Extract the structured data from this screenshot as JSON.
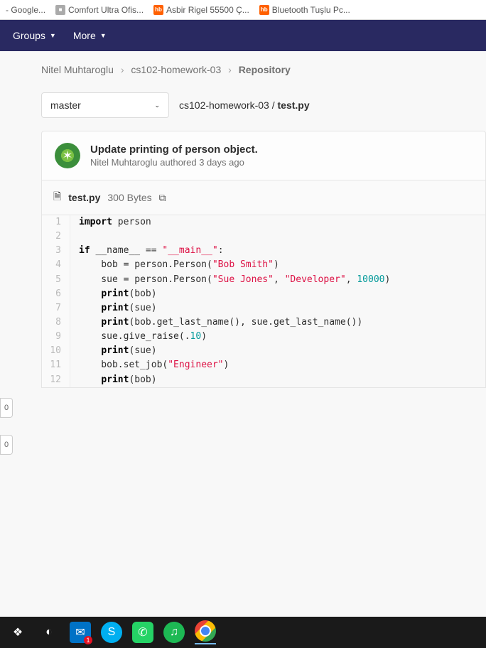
{
  "bookmarks": {
    "b0": "- Google...",
    "b1": "Comfort Ultra Ofis...",
    "b2": "Asbir Rigel 55500 Ç...",
    "b3": "Bluetooth Tuşlu Pc...",
    "hb": "hb"
  },
  "nav": {
    "groups": "Groups",
    "more": "More"
  },
  "breadcrumb": {
    "user": "Nitel Muhtaroglu",
    "project": "cs102-homework-03",
    "page": "Repository"
  },
  "branch": {
    "name": "master"
  },
  "path": {
    "folder": "cs102-homework-03",
    "sep": " / ",
    "file": "test.py"
  },
  "commit": {
    "title": "Update printing of person object.",
    "author": "Nitel Muhtaroglu",
    "verb": " authored ",
    "time": "3 days ago"
  },
  "fileheader": {
    "name": "test.py",
    "size": "300 Bytes"
  },
  "code": {
    "lines": [
      {
        "n": "1",
        "html": "<span class='kw'>import</span> person"
      },
      {
        "n": "2",
        "html": ""
      },
      {
        "n": "3",
        "html": "<span class='kw'>if</span> __name__ == <span class='str'>\"__main__\"</span>:"
      },
      {
        "n": "4",
        "html": "    bob = person.Person(<span class='str'>\"Bob Smith\"</span>)"
      },
      {
        "n": "5",
        "html": "    sue = person.Person(<span class='str'>\"Sue Jones\"</span>, <span class='str'>\"Developer\"</span>, <span class='num'>10000</span>)"
      },
      {
        "n": "6",
        "html": "    <span class='kw'>print</span>(bob)"
      },
      {
        "n": "7",
        "html": "    <span class='kw'>print</span>(sue)"
      },
      {
        "n": "8",
        "html": "    <span class='kw'>print</span>(bob.get_last_name(), sue.get_last_name())"
      },
      {
        "n": "9",
        "html": "    sue.give_raise(.<span class='num'>10</span>)"
      },
      {
        "n": "10",
        "html": "    <span class='kw'>print</span>(sue)"
      },
      {
        "n": "11",
        "html": "    bob.set_job(<span class='str'>\"Engineer\"</span>)"
      },
      {
        "n": "12",
        "html": "    <span class='kw'>print</span>(bob)"
      }
    ]
  },
  "sidetabs": {
    "a": "0",
    "b": "0"
  },
  "taskbar": {
    "mail_badge": "1"
  }
}
